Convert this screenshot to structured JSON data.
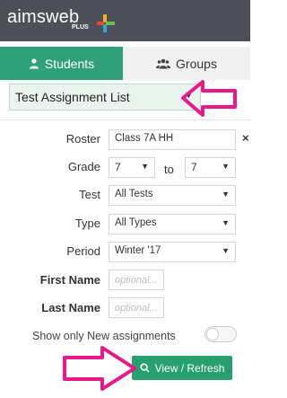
{
  "brand": {
    "logo_text": "aimsweb",
    "logo_sub": "PLUS"
  },
  "tabs": [
    {
      "label": "Students",
      "icon": "person-icon"
    },
    {
      "label": "Groups",
      "icon": "group-icon"
    }
  ],
  "view_select": {
    "value": "Test Assignment List"
  },
  "form": {
    "roster": {
      "label": "Roster",
      "value": "Class 7A HH",
      "clear": "×"
    },
    "grade": {
      "label": "Grade",
      "from": "7",
      "to_label": "to",
      "to": "7"
    },
    "test": {
      "label": "Test",
      "value": "All Tests"
    },
    "type": {
      "label": "Type",
      "value": "All Types"
    },
    "period": {
      "label": "Period",
      "value": "Winter '17"
    },
    "first_name": {
      "label": "First Name",
      "placeholder": "optional..."
    },
    "last_name": {
      "label": "Last Name",
      "placeholder": "optional..."
    }
  },
  "toggle": {
    "label": "Show only New assignments",
    "on": false
  },
  "view_refresh": {
    "label": "View / Refresh"
  },
  "colors": {
    "header": "#4d5059",
    "accent": "#2fa07a",
    "button": "#27a06f",
    "annotation": "#e8198b"
  }
}
